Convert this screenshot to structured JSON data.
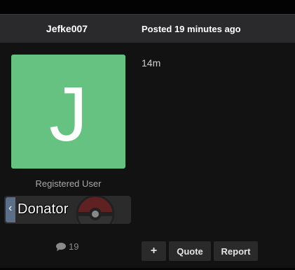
{
  "post": {
    "author": "Jefke007",
    "posted": "Posted 19 minutes ago",
    "avatar_letter": "J",
    "avatar_color": "#66c280",
    "user_title": "Registered User",
    "badge": {
      "label": "Donator",
      "chevron": "‹",
      "icon": "pokeball-icon"
    },
    "post_count": "19",
    "content": "14m",
    "actions": {
      "plus_label": "+",
      "quote_label": "Quote",
      "report_label": "Report"
    }
  }
}
